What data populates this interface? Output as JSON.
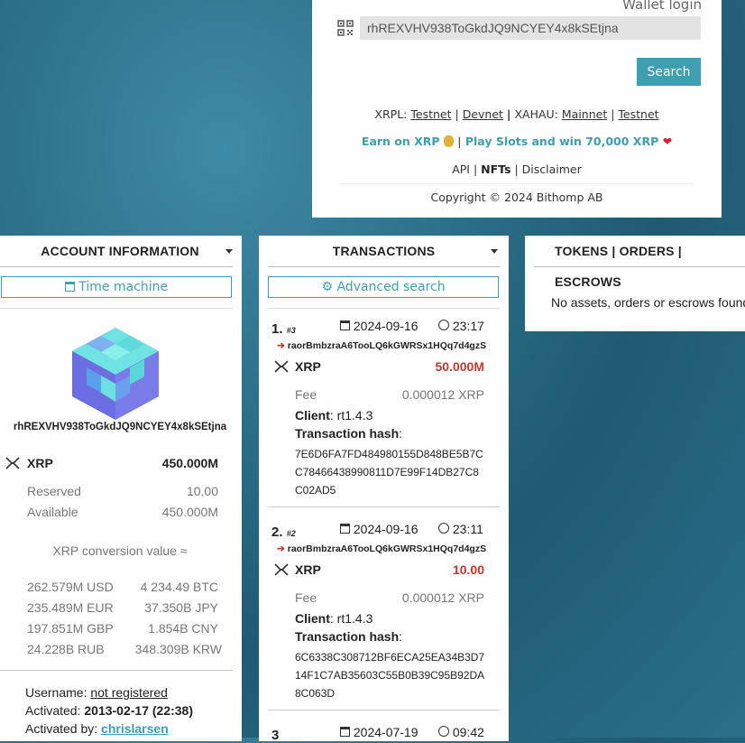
{
  "top": {
    "wallet_login": "Wallet login",
    "search_value": "rhREXVHV938ToGkdJQ9NCYEY4x8kSEtjna",
    "search_button": "Search",
    "xrpl_label": "XRPL:",
    "xrpl_testnet": "Testnet",
    "xrpl_devnet": "Devnet",
    "xahau_label": "XAHAU:",
    "xahau_mainnet": "Mainnet",
    "xahau_testnet": "Testnet",
    "earn": "Earn on XRP",
    "slots": "Play Slots and win 70,000 XRP",
    "api": "API",
    "nfts": "NFTs",
    "disclaimer": "Disclaimer",
    "copyright": "Copyright © 2024 Bithomp AB"
  },
  "account": {
    "title": "ACCOUNT INFORMATION",
    "time_machine": "Time machine",
    "address": "rhREXVHV938ToGkdJQ9NCYEY4x8kSEtjna",
    "currency": "XRP",
    "balance": "450.000M",
    "reserved_label": "Reserved",
    "reserved": "10.00",
    "available_label": "Available",
    "available": "450.000M",
    "conversion_title": "XRP conversion value ≈",
    "conversions": [
      [
        "262.579M USD",
        "4 234.49 BTC"
      ],
      [
        "235.489M EUR",
        "37.350B JPY"
      ],
      [
        "197.851M GBP",
        "1.854B CNY"
      ],
      [
        "24.228B RUB",
        "348.309B KRW"
      ]
    ],
    "username_label": "Username:",
    "username": "not registered",
    "activated_label": "Activated:",
    "activated": "2013-02-17 (22:38)",
    "activated_by_label": "Activated by:",
    "activated_by": "chrislarsen"
  },
  "transactions": {
    "title": "TRANSACTIONS",
    "advanced_search": "Advanced search",
    "items": [
      {
        "num": "1.",
        "seq": "#3",
        "date": "2024-09-16",
        "time": "23:17",
        "dest": "raorBmbzraA6TooLQ6kGWRSx1HQq7d4gzS",
        "currency": "XRP",
        "amount": "50.000M",
        "fee_label": "Fee",
        "fee": "0.000012 XRP",
        "client_label": "Client",
        "client": ": rt1.4.3",
        "hash_label": "Transaction hash",
        "hash": [
          "7E6D6FA7FD484980155D848BE5B7C",
          "C7846643899081 1D7E99F14DB27C8",
          "C02AD5"
        ]
      },
      {
        "num": "2.",
        "seq": "#2",
        "date": "2024-09-16",
        "time": "23:11",
        "dest": "raorBmbzraA6TooLQ6kGWRSx1HQq7d4gzS",
        "currency": "XRP",
        "amount": "10.00",
        "fee_label": "Fee",
        "fee": "0.000012 XRP",
        "client_label": "Client",
        "client": ": rt1.4.3",
        "hash_label": "Transaction hash",
        "hash": [
          "6C6338C308712BF6ECA25EA34B3D7",
          "14F1C7AB35603C55B0B39C95B92DA",
          "8C063D"
        ]
      },
      {
        "num": "3",
        "date": "2024-07-19",
        "time": "09:42"
      }
    ]
  },
  "tokens": {
    "title": "TOKENS | ORDERS | ESCROWS",
    "empty": "No assets, orders or escrows found"
  }
}
